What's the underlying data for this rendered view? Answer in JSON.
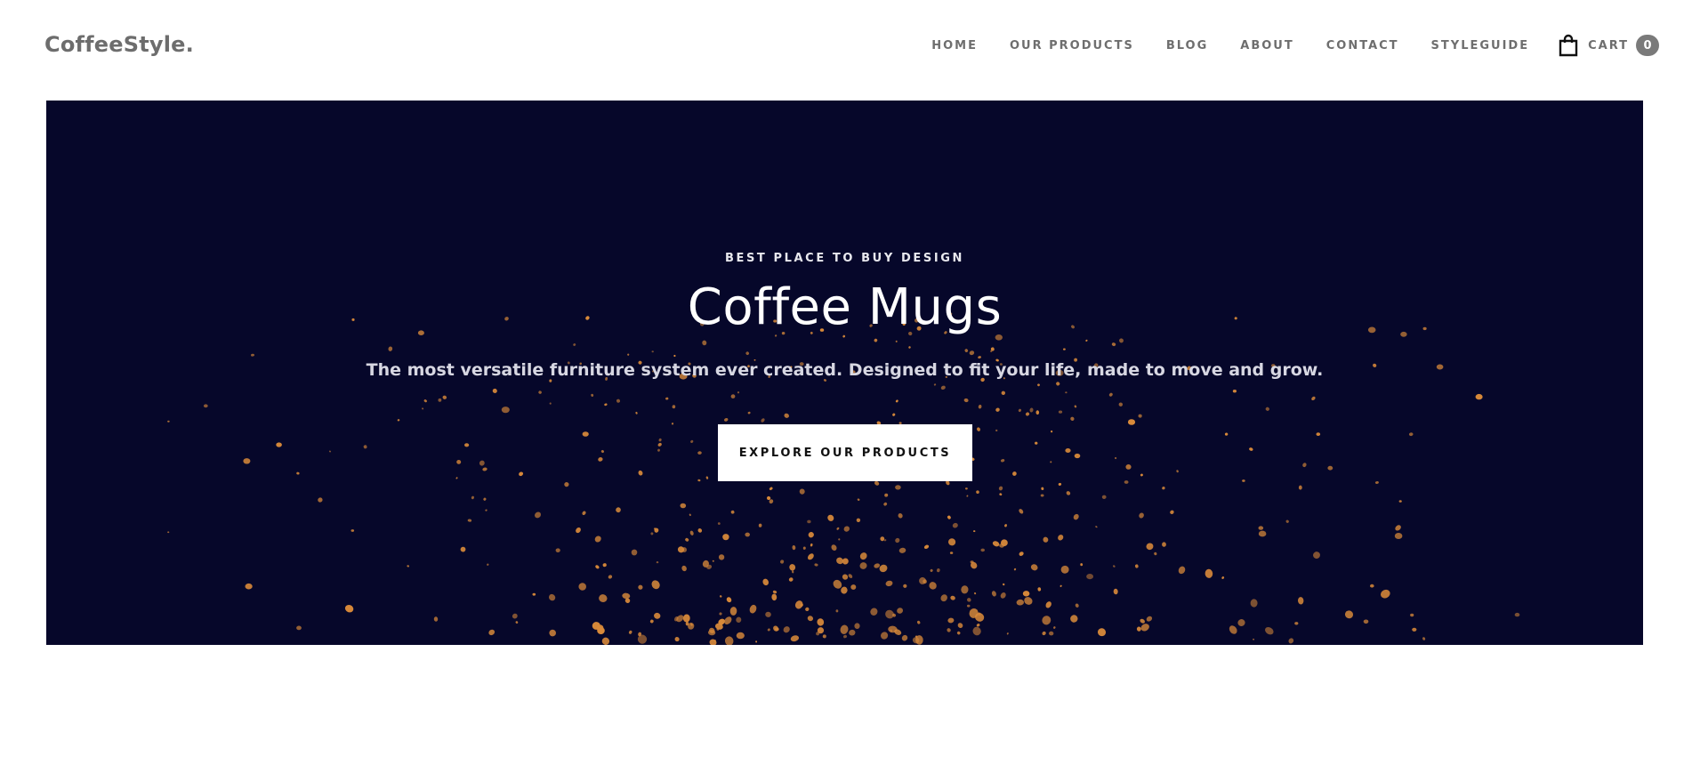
{
  "brand": {
    "logo_text": "CoffeeStyle."
  },
  "nav": {
    "items": [
      {
        "label": "HOME"
      },
      {
        "label": "OUR PRODUCTS"
      },
      {
        "label": "BLOG"
      },
      {
        "label": "ABOUT"
      },
      {
        "label": "CONTACT"
      },
      {
        "label": "STYLEGUIDE"
      }
    ],
    "cart": {
      "label": "CART",
      "count": "0",
      "icon": "shopping-bag-icon"
    }
  },
  "hero": {
    "eyebrow": "BEST PLACE TO BUY DESIGN",
    "title": "Coffee Mugs",
    "subtitle": "The most versatile furniture system ever created. Designed to fit your life, made to move and grow.",
    "cta_label": "EXPLORE OUR PRODUCTS",
    "background_color": "#06072a",
    "particle_color": "#d98a3a"
  },
  "colors": {
    "nav_text": "#6e6e6e",
    "cart_badge": "#7a7a7a",
    "hero_bg": "#06072a"
  }
}
